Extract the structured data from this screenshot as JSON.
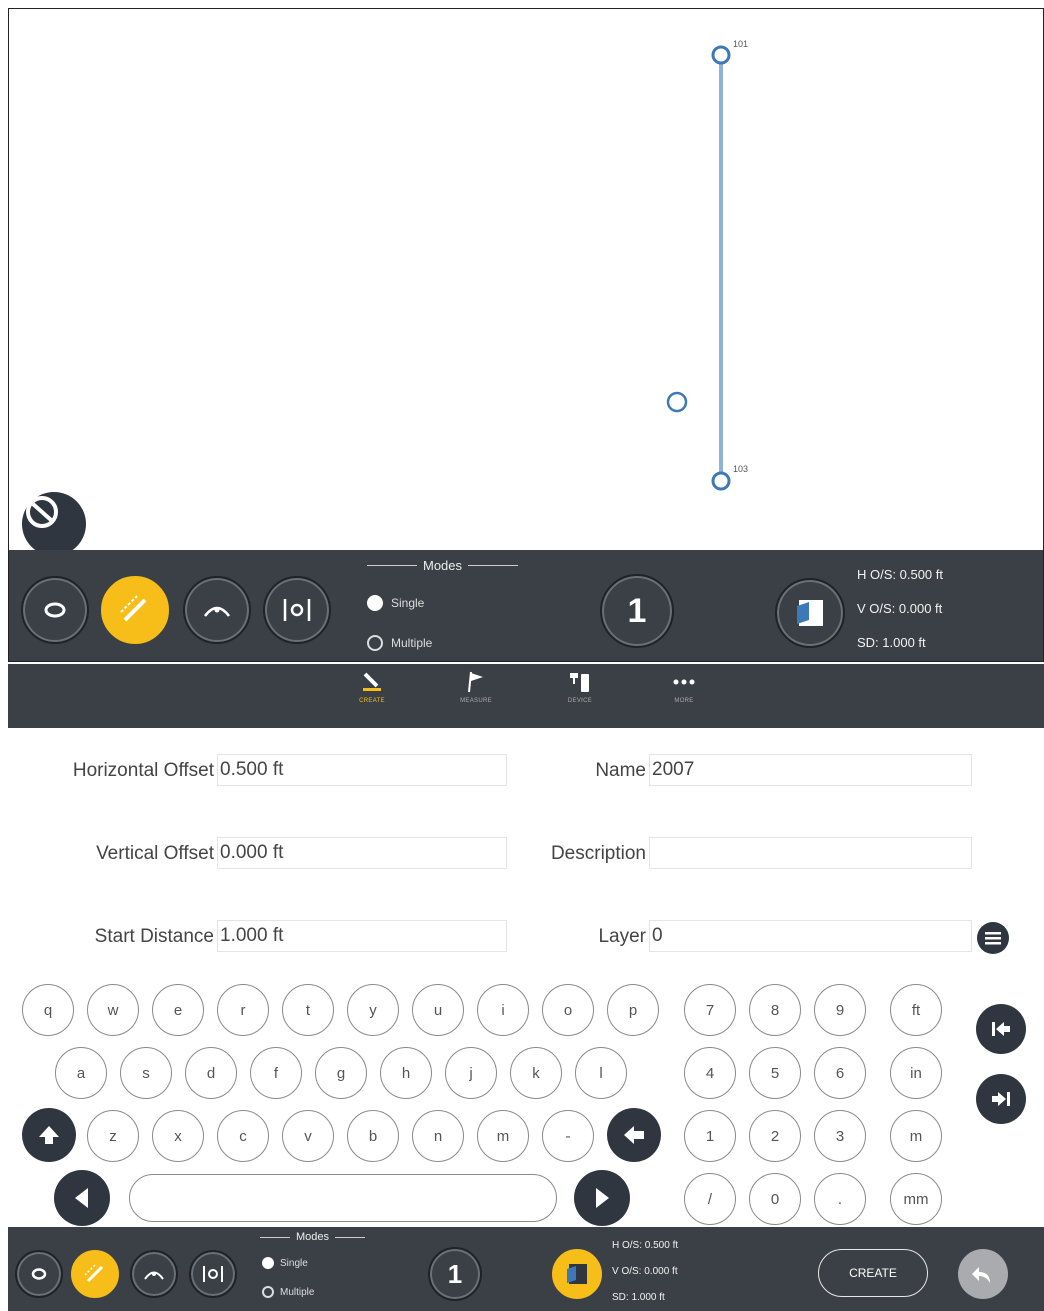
{
  "map": {
    "point_top_label": "101",
    "point_bottom_label": "103"
  },
  "toolbar": {
    "modes_title": "Modes",
    "mode_single": "Single",
    "mode_multiple": "Multiple",
    "count": "1",
    "h_offset": "H O/S: 0.500 ft",
    "v_offset": "V O/S: 0.000 ft",
    "start_distance": "SD: 1.000 ft",
    "selected_mode": "Single",
    "active_tool": "offset-line-tool"
  },
  "tabs": [
    {
      "label": "CREATE",
      "icon": "pencil-icon",
      "active": true
    },
    {
      "label": "MEASURE",
      "icon": "flag-icon",
      "active": false
    },
    {
      "label": "DEVICE",
      "icon": "device-icon",
      "active": false
    },
    {
      "label": "MORE",
      "icon": "more-icon",
      "active": false
    }
  ],
  "form": {
    "horizontal_offset_label": "Horizontal Offset",
    "horizontal_offset_value": "0.500 ft",
    "vertical_offset_label": "Vertical Offset",
    "vertical_offset_value": "0.000 ft",
    "start_distance_label": "Start Distance",
    "start_distance_value": "1.000 ft",
    "name_label": "Name",
    "name_value": "2007",
    "description_label": "Description",
    "description_value": "",
    "layer_label": "Layer",
    "layer_value": "0"
  },
  "keyboard": {
    "row1": [
      "q",
      "w",
      "e",
      "r",
      "t",
      "y",
      "u",
      "i",
      "o",
      "p"
    ],
    "row2": [
      "a",
      "s",
      "d",
      "f",
      "g",
      "h",
      "j",
      "k",
      "l"
    ],
    "row3": [
      "z",
      "x",
      "c",
      "v",
      "b",
      "n",
      "m",
      "-"
    ],
    "numpad": [
      [
        "7",
        "8",
        "9",
        "ft"
      ],
      [
        "4",
        "5",
        "6",
        "in"
      ],
      [
        "1",
        "2",
        "3",
        "m"
      ],
      [
        "/",
        "0",
        ".",
        "mm"
      ]
    ]
  },
  "bottom_toolbar": {
    "modes_title": "Modes",
    "mode_single": "Single",
    "mode_multiple": "Multiple",
    "count": "1",
    "h_offset": "H O/S: 0.500 ft",
    "v_offset": "V O/S: 0.000 ft",
    "start_distance": "SD: 1.000 ft",
    "create_label": "CREATE"
  },
  "colors": {
    "toolbar": "#3b4047",
    "accent": "#f7bd18",
    "line": "#8fb3d6",
    "point": "#3d78b8"
  }
}
